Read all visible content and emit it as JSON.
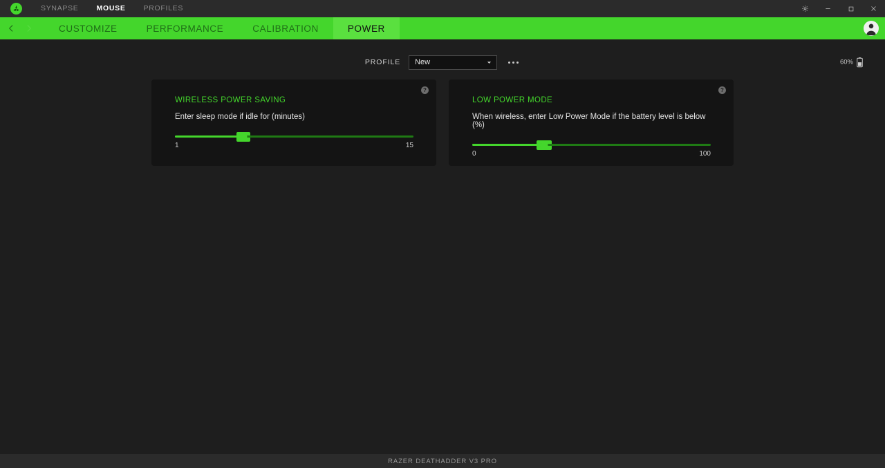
{
  "titlebar": {
    "logo_icon": "razer-logo-icon",
    "nav": [
      {
        "label": "SYNAPSE",
        "active": false
      },
      {
        "label": "MOUSE",
        "active": true
      },
      {
        "label": "PROFILES",
        "active": false
      }
    ],
    "controls": {
      "settings": "gear-icon",
      "minimize": "minimize-icon",
      "maximize": "maximize-icon",
      "close": "close-icon"
    }
  },
  "tabbar": {
    "back": "chevron-left-icon",
    "forward": "chevron-right-icon",
    "tabs": [
      {
        "label": "CUSTOMIZE",
        "active": false
      },
      {
        "label": "PERFORMANCE",
        "active": false
      },
      {
        "label": "CALIBRATION",
        "active": false
      },
      {
        "label": "POWER",
        "active": true
      }
    ],
    "avatar": "user-avatar-icon"
  },
  "profile": {
    "label": "PROFILE",
    "selected": "New",
    "dropdown_icon": "chevron-down-icon",
    "more_icon": "more-options-icon"
  },
  "battery": {
    "percent": "60%",
    "icon": "battery-icon",
    "level": 60
  },
  "cards": [
    {
      "title": "WIRELESS POWER SAVING",
      "description": "Enter sleep mode if idle for (minutes)",
      "help_icon": "help-icon",
      "help_glyph": "?",
      "slider": {
        "value": 5,
        "value_label": "5",
        "min": 1,
        "max": 15,
        "min_label": "1",
        "max_label": "15",
        "percent": 28.6
      }
    },
    {
      "title": "LOW POWER MODE",
      "description": "When wireless, enter Low Power Mode if the battery level is below (%)",
      "help_icon": "help-icon",
      "help_glyph": "?",
      "slider": {
        "value": 30,
        "value_label": "30",
        "min": 0,
        "max": 100,
        "min_label": "0",
        "max_label": "100",
        "percent": 30
      }
    }
  ],
  "footer": {
    "device": "RAZER DEATHADDER V3 PRO"
  },
  "colors": {
    "accent_green": "#44d62c",
    "tab_active_green": "#5ae03f",
    "page_bg": "#1e1e1e",
    "card_bg": "#141414",
    "chrome_bg": "#2b2b2b"
  }
}
